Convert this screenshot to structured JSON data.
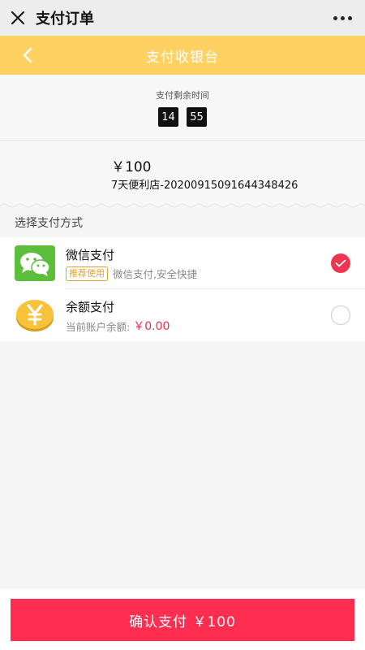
{
  "titlebar": {
    "title": "支付订单",
    "close_icon": "close-icon",
    "more_icon": "more-icon"
  },
  "navbar": {
    "title": "支付收银台",
    "back_icon": "chevron-left-icon",
    "bg_color": "#ffd163"
  },
  "timer": {
    "label": "支付剩余时间",
    "minutes": "14",
    "seconds": "55"
  },
  "order": {
    "amount": "￥100",
    "name": "7天便利店-20200915091644348426"
  },
  "payment": {
    "section_title": "选择支付方式",
    "methods": [
      {
        "name": "微信支付",
        "badge": "推荐使用",
        "desc": "微信支付,安全快捷",
        "icon": "wechat-pay-icon",
        "selected": true
      },
      {
        "name": "余额支付",
        "desc": "当前账户余额:",
        "balance": "￥0.00",
        "icon": "yuan-coin-icon",
        "selected": false
      }
    ]
  },
  "confirm": {
    "label": "确认支付 ￥100",
    "color": "#ff2d50"
  }
}
